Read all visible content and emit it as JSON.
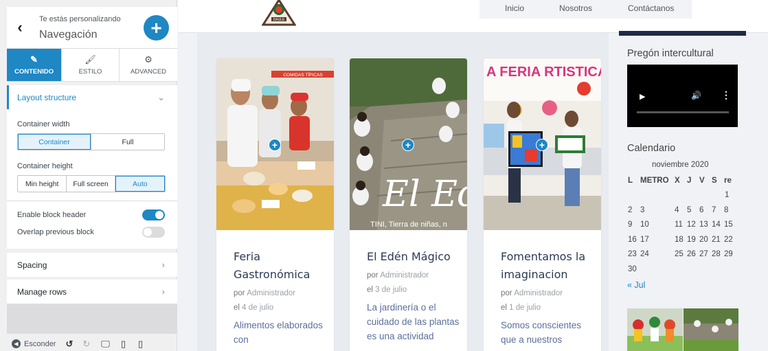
{
  "sidebar": {
    "customizing_label": "Te estás personalizando",
    "title": "Navegación",
    "tabs": [
      {
        "label": "CONTENIDO",
        "icon": "pencil-icon"
      },
      {
        "label": "ESTILO",
        "icon": "brush-icon"
      },
      {
        "label": "ADVANCED",
        "icon": "gears-icon"
      }
    ],
    "layout_section": "Layout structure",
    "container_width": {
      "label": "Container width",
      "options": [
        "Container",
        "Full"
      ],
      "selected": "Container"
    },
    "container_height": {
      "label": "Container height",
      "options": [
        "Min height",
        "Full screen",
        "Auto"
      ],
      "selected": "Auto"
    },
    "enable_block_header": {
      "label": "Enable block header",
      "on": true
    },
    "overlap_previous_block": {
      "label": "Overlap previous block",
      "on": false
    },
    "spacing_section": "Spacing",
    "manage_rows_section": "Manage rows",
    "footer": {
      "hide_label": "Esconder"
    }
  },
  "preview": {
    "nav": [
      "Inicio",
      "Nosotros",
      "Contáctanos"
    ],
    "logo_text": "DAULE",
    "posts": [
      {
        "title": "Feria Gastronómica",
        "by": "por",
        "author": "Administrador",
        "on": "el",
        "date": "4 de julio",
        "excerpt": "Alimentos elaborados con",
        "banner_text": "COMIDAS TÍPICAS"
      },
      {
        "title": "El Edén Mágico",
        "by": "por",
        "author": "Administrador",
        "on": "el",
        "date": "3 de julio",
        "excerpt": "La jardinería o el cuidado de las plantas es una actividad",
        "overlay_big": "El Edé",
        "overlay_small": "TINI, Tierra de niñas, n"
      },
      {
        "title": "Fomentamos la imaginacion",
        "by": "por",
        "author": "Administrador",
        "on": "el",
        "date": "1 de julio",
        "excerpt": "Somos conscientes que a nuestros",
        "banner_text": "A FERIA RTISTICAS"
      }
    ],
    "widgets": {
      "pregon_title": "Pregón intercultural",
      "calendar_title": "Calendario",
      "calendar_month": "noviembre 2020",
      "calendar_headers": [
        "L",
        "METRO",
        "X",
        "J",
        "V",
        "S",
        "re"
      ],
      "calendar_rows": [
        [
          "",
          "",
          "",
          "",
          "",
          "",
          "1"
        ],
        [
          "2",
          "3",
          "",
          "4",
          "5",
          "6",
          "7",
          "8"
        ],
        [
          "9",
          "10",
          "",
          "11",
          "12",
          "13",
          "14",
          "15"
        ],
        [
          "16",
          "17",
          "",
          "18",
          "19",
          "20",
          "21",
          "22"
        ],
        [
          "23",
          "24",
          "",
          "25",
          "26",
          "27",
          "28",
          "29"
        ],
        [
          "30"
        ]
      ],
      "prev_link": "« Jul"
    }
  },
  "colors": {
    "accent": "#1e87c4",
    "navy": "#1f2a44",
    "link": "#5a6f9a"
  }
}
